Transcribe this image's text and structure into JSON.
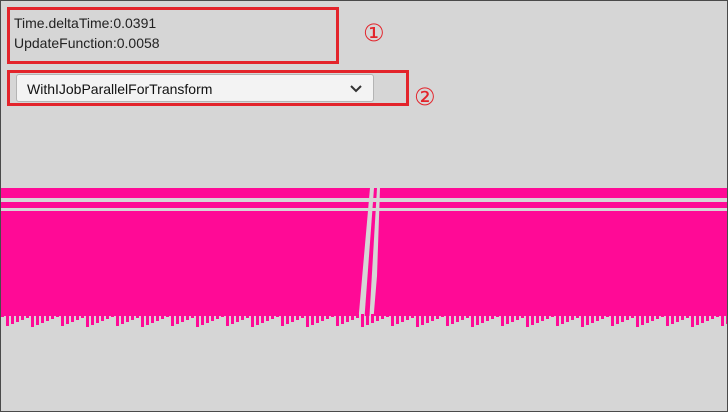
{
  "stats": {
    "delta_time": "Time.deltaTime:0.0391",
    "update_function": "UpdateFunction:0.0058"
  },
  "dropdown": {
    "selected": "WithIJobParallelForTransform"
  },
  "annotations": {
    "marker_1": "①",
    "marker_2": "②"
  },
  "colors": {
    "object_color": "#ff0a96",
    "highlight": "#e3242b",
    "background": "#d6d6d6"
  }
}
